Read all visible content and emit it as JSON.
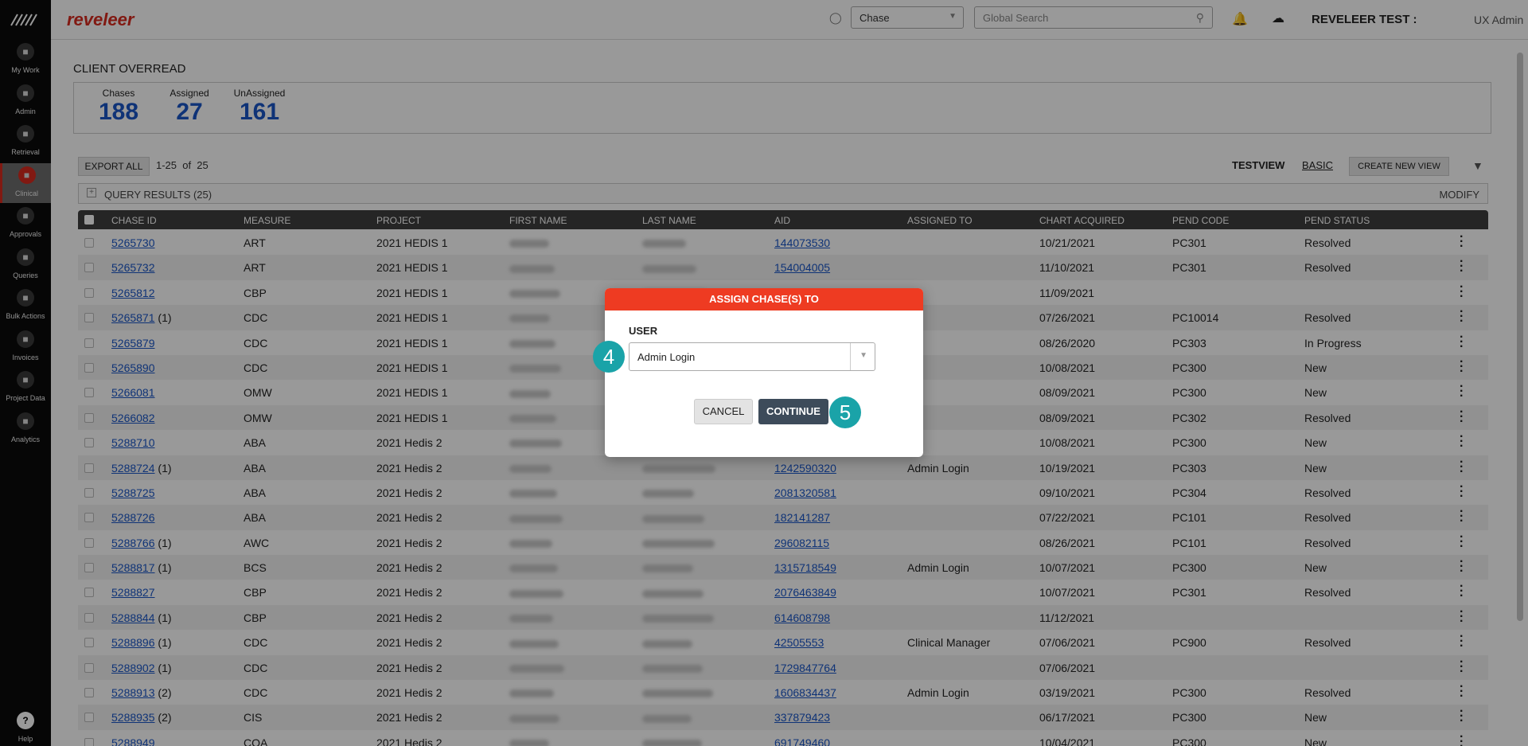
{
  "sidebar": {
    "items": [
      {
        "label": "My Work",
        "icon": "home-icon"
      },
      {
        "label": "Admin",
        "icon": "admin-icon"
      },
      {
        "label": "Retrieval",
        "icon": "retrieval-icon"
      },
      {
        "label": "Clinical",
        "icon": "clinical-icon",
        "active": true
      },
      {
        "label": "Approvals",
        "icon": "approvals-icon"
      },
      {
        "label": "Queries",
        "icon": "queries-icon"
      },
      {
        "label": "Bulk Actions",
        "icon": "bulk-actions-icon"
      },
      {
        "label": "Invoices",
        "icon": "invoices-icon"
      },
      {
        "label": "Project Data",
        "icon": "project-data-icon"
      },
      {
        "label": "Analytics",
        "icon": "analytics-icon"
      }
    ],
    "help_label": "Help"
  },
  "topbar": {
    "brand": "reveleer",
    "chase_select": "Chase",
    "search_placeholder": "Global Search",
    "user_title": "REVELEER TEST :",
    "user_role": "UX Admin"
  },
  "page": {
    "title": "CLIENT OVERREAD",
    "stats": [
      {
        "label": "Chases",
        "value": "188"
      },
      {
        "label": "Assigned",
        "value": "27"
      },
      {
        "label": "UnAssigned",
        "value": "161"
      }
    ]
  },
  "toolbar": {
    "export_label": "EXPORT ALL",
    "range_text": "1-25  of  25",
    "view_name": "TESTVIEW",
    "basic_label": "BASIC",
    "new_view_label": "CREATE NEW VIEW",
    "query_results": "QUERY RESULTS (25)",
    "modify_label": "MODIFY"
  },
  "table": {
    "columns": [
      "CHASE ID",
      "MEASURE",
      "PROJECT",
      "FIRST NAME",
      "LAST NAME",
      "AID",
      "ASSIGNED TO",
      "CHART ACQUIRED",
      "PEND CODE",
      "PEND STATUS"
    ],
    "rows": [
      {
        "chase_id": "5265730",
        "count": "",
        "measure": "ART",
        "project": "2021 HEDIS 1",
        "aid": "144073530",
        "assigned": "",
        "acquired": "10/21/2021",
        "pend_code": "PC301",
        "pend_status": "Resolved"
      },
      {
        "chase_id": "5265732",
        "count": "",
        "measure": "ART",
        "project": "2021 HEDIS 1",
        "aid": "154004005",
        "assigned": "",
        "acquired": "11/10/2021",
        "pend_code": "PC301",
        "pend_status": "Resolved"
      },
      {
        "chase_id": "5265812",
        "count": "",
        "measure": "CBP",
        "project": "2021 HEDIS 1",
        "aid": "",
        "assigned": "",
        "acquired": "11/09/2021",
        "pend_code": "",
        "pend_status": ""
      },
      {
        "chase_id": "5265871",
        "count": "(1)",
        "measure": "CDC",
        "project": "2021 HEDIS 1",
        "aid": "",
        "assigned": "",
        "acquired": "07/26/2021",
        "pend_code": "PC10014",
        "pend_status": "Resolved"
      },
      {
        "chase_id": "5265879",
        "count": "",
        "measure": "CDC",
        "project": "2021 HEDIS 1",
        "aid": "",
        "assigned": "",
        "acquired": "08/26/2020",
        "pend_code": "PC303",
        "pend_status": "In Progress"
      },
      {
        "chase_id": "5265890",
        "count": "",
        "measure": "CDC",
        "project": "2021 HEDIS 1",
        "aid": "",
        "assigned": "",
        "acquired": "10/08/2021",
        "pend_code": "PC300",
        "pend_status": "New"
      },
      {
        "chase_id": "5266081",
        "count": "",
        "measure": "OMW",
        "project": "2021 HEDIS 1",
        "aid": "",
        "assigned": "",
        "acquired": "08/09/2021",
        "pend_code": "PC300",
        "pend_status": "New"
      },
      {
        "chase_id": "5266082",
        "count": "",
        "measure": "OMW",
        "project": "2021 HEDIS 1",
        "aid": "",
        "assigned": "",
        "acquired": "08/09/2021",
        "pend_code": "PC302",
        "pend_status": "Resolved"
      },
      {
        "chase_id": "5288710",
        "count": "",
        "measure": "ABA",
        "project": "2021 Hedis 2",
        "aid": "",
        "assigned": "",
        "acquired": "10/08/2021",
        "pend_code": "PC300",
        "pend_status": "New"
      },
      {
        "chase_id": "5288724",
        "count": "(1)",
        "measure": "ABA",
        "project": "2021 Hedis 2",
        "aid": "1242590320",
        "assigned": "Admin Login",
        "acquired": "10/19/2021",
        "pend_code": "PC303",
        "pend_status": "New"
      },
      {
        "chase_id": "5288725",
        "count": "",
        "measure": "ABA",
        "project": "2021 Hedis 2",
        "aid": "2081320581",
        "assigned": "",
        "acquired": "09/10/2021",
        "pend_code": "PC304",
        "pend_status": "Resolved"
      },
      {
        "chase_id": "5288726",
        "count": "",
        "measure": "ABA",
        "project": "2021 Hedis 2",
        "aid": "182141287",
        "assigned": "",
        "acquired": "07/22/2021",
        "pend_code": "PC101",
        "pend_status": "Resolved"
      },
      {
        "chase_id": "5288766",
        "count": "(1)",
        "measure": "AWC",
        "project": "2021 Hedis 2",
        "aid": "296082115",
        "assigned": "",
        "acquired": "08/26/2021",
        "pend_code": "PC101",
        "pend_status": "Resolved"
      },
      {
        "chase_id": "5288817",
        "count": "(1)",
        "measure": "BCS",
        "project": "2021 Hedis 2",
        "aid": "1315718549",
        "assigned": "Admin Login",
        "acquired": "10/07/2021",
        "pend_code": "PC300",
        "pend_status": "New"
      },
      {
        "chase_id": "5288827",
        "count": "",
        "measure": "CBP",
        "project": "2021 Hedis 2",
        "aid": "2076463849",
        "assigned": "",
        "acquired": "10/07/2021",
        "pend_code": "PC301",
        "pend_status": "Resolved"
      },
      {
        "chase_id": "5288844",
        "count": "(1)",
        "measure": "CBP",
        "project": "2021 Hedis 2",
        "aid": "614608798",
        "assigned": "",
        "acquired": "11/12/2021",
        "pend_code": "",
        "pend_status": ""
      },
      {
        "chase_id": "5288896",
        "count": "(1)",
        "measure": "CDC",
        "project": "2021 Hedis 2",
        "aid": "42505553",
        "assigned": "Clinical Manager",
        "acquired": "07/06/2021",
        "pend_code": "PC900",
        "pend_status": "Resolved"
      },
      {
        "chase_id": "5288902",
        "count": "(1)",
        "measure": "CDC",
        "project": "2021 Hedis 2",
        "aid": "1729847764",
        "assigned": "",
        "acquired": "07/06/2021",
        "pend_code": "",
        "pend_status": ""
      },
      {
        "chase_id": "5288913",
        "count": "(2)",
        "measure": "CDC",
        "project": "2021 Hedis 2",
        "aid": "1606834437",
        "assigned": "Admin Login",
        "acquired": "03/19/2021",
        "pend_code": "PC300",
        "pend_status": "Resolved"
      },
      {
        "chase_id": "5288935",
        "count": "(2)",
        "measure": "CIS",
        "project": "2021 Hedis 2",
        "aid": "337879423",
        "assigned": "",
        "acquired": "06/17/2021",
        "pend_code": "PC300",
        "pend_status": "New"
      },
      {
        "chase_id": "5288949",
        "count": "",
        "measure": "COA",
        "project": "2021 Hedis 2",
        "aid": "691749460",
        "assigned": "",
        "acquired": "10/04/2021",
        "pend_code": "PC300",
        "pend_status": "New"
      }
    ]
  },
  "modal": {
    "title": "ASSIGN CHASE(S) TO",
    "user_label": "USER",
    "user_value": "Admin Login",
    "cancel_label": "CANCEL",
    "continue_label": "CONTINUE",
    "step_user": "4",
    "step_continue": "5",
    "header_color": "#ee3b22",
    "badge_color": "#1aa3a8"
  }
}
